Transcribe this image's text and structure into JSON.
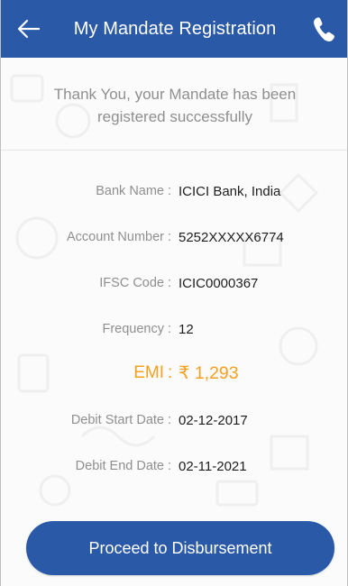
{
  "header": {
    "title": "My Mandate Registration",
    "back_icon": "arrow-left-icon",
    "call_icon": "phone-icon"
  },
  "message": {
    "line1": "Thank You, your Mandate has been",
    "line2": "registered successfully"
  },
  "details": [
    {
      "label": "Bank Name",
      "value": "ICICI Bank, India"
    },
    {
      "label": "Account Number",
      "value": "5252XXXXX6774"
    },
    {
      "label": "IFSC Code",
      "value": "ICIC0000367"
    },
    {
      "label": "Frequency",
      "value": "12"
    },
    {
      "label": "EMI",
      "value": "₹ 1,293"
    },
    {
      "label": "Debit Start Date",
      "value": "02-12-2017"
    },
    {
      "label": "Debit End Date",
      "value": "02-11-2021"
    }
  ],
  "action": {
    "proceed_label": "Proceed to Disbursement"
  },
  "colors": {
    "brand": "#2a59a8",
    "emi": "#f5a020"
  }
}
